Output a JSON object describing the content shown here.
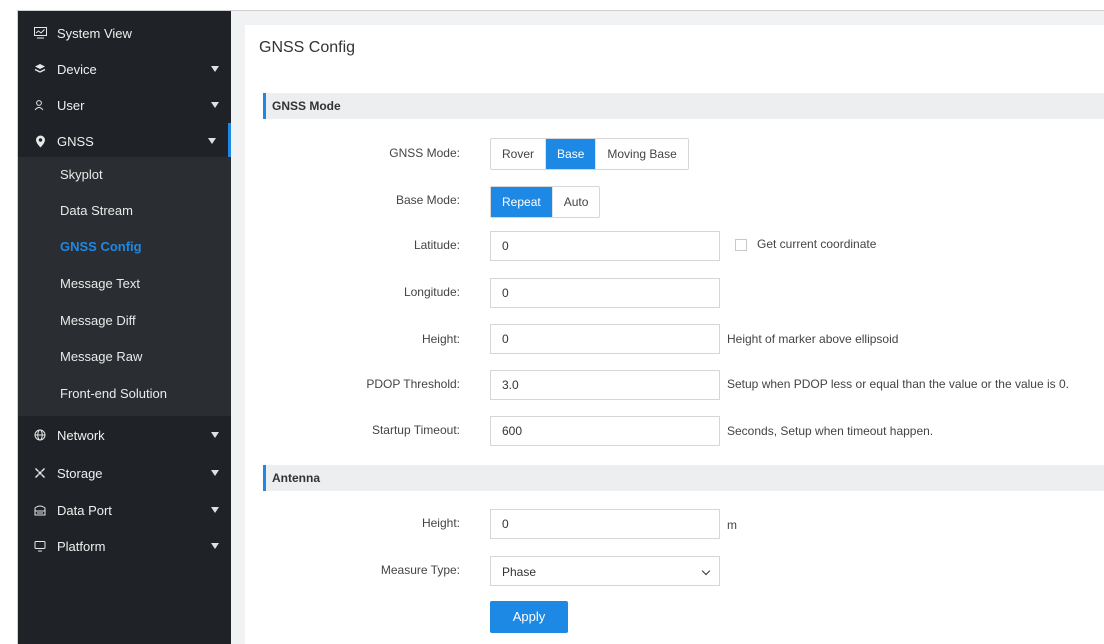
{
  "sidebar": {
    "items": [
      {
        "label": "System View",
        "icon": "monitor-icon"
      },
      {
        "label": "Device",
        "icon": "layers-icon"
      },
      {
        "label": "User",
        "icon": "user-icon"
      },
      {
        "label": "GNSS",
        "icon": "location-pin-icon"
      },
      {
        "label": "Network",
        "icon": "globe-icon"
      },
      {
        "label": "Storage",
        "icon": "storage-icon"
      },
      {
        "label": "Data Port",
        "icon": "data-port-icon"
      },
      {
        "label": "Platform",
        "icon": "platform-icon"
      }
    ],
    "gnss_submenu": [
      {
        "label": "Skyplot"
      },
      {
        "label": "Data Stream"
      },
      {
        "label": "GNSS Config"
      },
      {
        "label": "Message Text"
      },
      {
        "label": "Message Diff"
      },
      {
        "label": "Message Raw"
      },
      {
        "label": "Front-end Solution"
      }
    ],
    "accent_color": "#1e88e5"
  },
  "page": {
    "title": "GNSS Config"
  },
  "gnss_mode_section": {
    "title": "GNSS Mode",
    "gnss_mode": {
      "label": "GNSS Mode:",
      "options": [
        "Rover",
        "Base",
        "Moving Base"
      ],
      "selected": "Base"
    },
    "base_mode": {
      "label": "Base Mode:",
      "options": [
        "Repeat",
        "Auto"
      ],
      "selected": "Repeat"
    },
    "latitude": {
      "label": "Latitude:",
      "value": "0",
      "checkbox_label": "Get current coordinate"
    },
    "longitude": {
      "label": "Longitude:",
      "value": "0"
    },
    "height": {
      "label": "Height:",
      "value": "0",
      "hint": "Height of marker above ellipsoid"
    },
    "pdop": {
      "label": "PDOP Threshold:",
      "value": "3.0",
      "hint": "Setup when PDOP less or equal than the value or the value is 0."
    },
    "startup_timeout": {
      "label": "Startup Timeout:",
      "value": "600",
      "hint": "Seconds, Setup when timeout happen."
    }
  },
  "antenna_section": {
    "title": "Antenna",
    "height": {
      "label": "Height:",
      "value": "0",
      "unit": "m"
    },
    "measure_type": {
      "label": "Measure Type:",
      "value": "Phase"
    },
    "apply_label": "Apply"
  }
}
